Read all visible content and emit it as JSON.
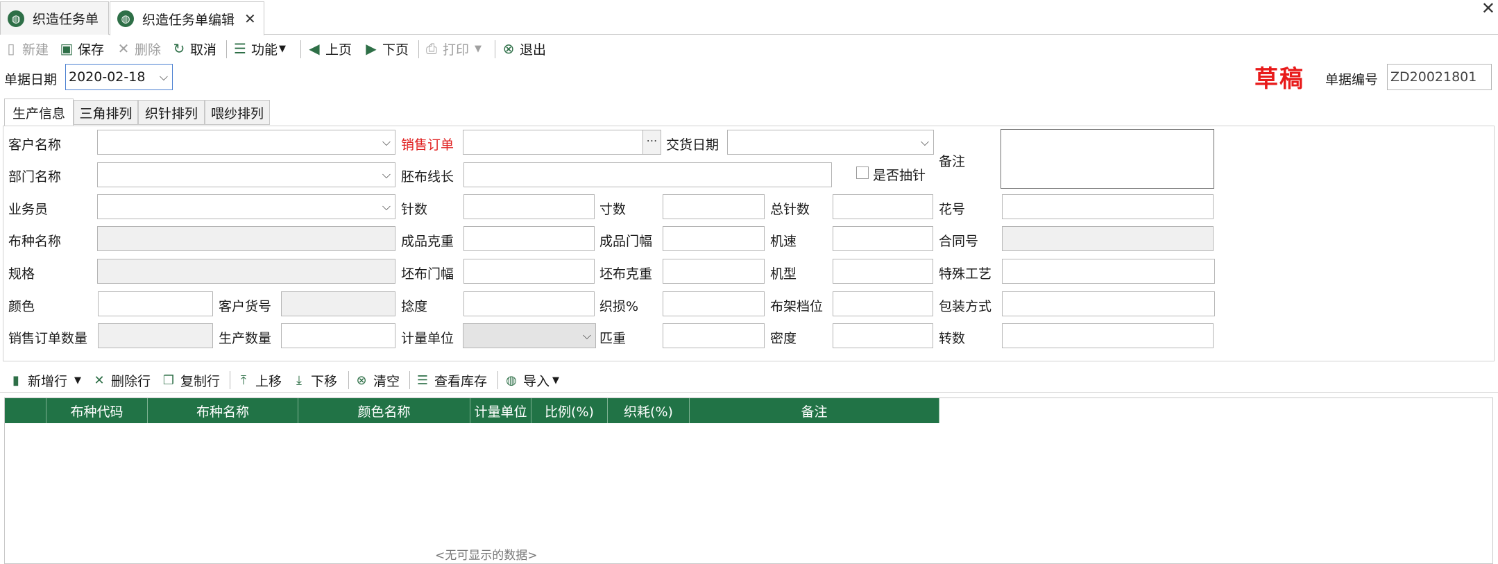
{
  "tabs": [
    {
      "label": "织造任务单"
    },
    {
      "label": "织造任务单编辑"
    }
  ],
  "toolbar": {
    "new": "新建",
    "save": "保存",
    "delete": "删除",
    "cancel": "取消",
    "function": "功能",
    "prev": "上页",
    "next": "下页",
    "print": "打印",
    "exit": "退出"
  },
  "header": {
    "date_label": "单据日期",
    "date_value": "2020-02-18",
    "status_stamp": "草稿",
    "docno_label": "单据编号",
    "docno_value": "ZD20021801"
  },
  "form_tabs": [
    "生产信息",
    "三角排列",
    "织针排列",
    "喂纱排列"
  ],
  "form": {
    "customer_name": "客户名称",
    "sales_order": "销售订单",
    "delivery_date": "交货日期",
    "remark": "备注",
    "dept_name": "部门名称",
    "grey_length": "胚布线长",
    "is_needle_draw": "是否抽针",
    "salesman": "业务员",
    "needle_count": "针数",
    "inch_count": "寸数",
    "total_needles": "总针数",
    "pattern_no": "花号",
    "fabric_name": "布种名称",
    "finished_weight": "成品克重",
    "finished_width": "成品门幅",
    "machine_speed": "机速",
    "contract_no": "合同号",
    "spec": "规格",
    "grey_width": "坯布门幅",
    "grey_weight": "坯布克重",
    "machine_type": "机型",
    "special_process": "特殊工艺",
    "color": "颜色",
    "customer_item_no": "客户货号",
    "twist": "捻度",
    "weaving_loss": "织损%",
    "rack_gear": "布架档位",
    "packing": "包装方式",
    "sales_qty": "销售订单数量",
    "production_qty": "生产数量",
    "unit": "计量单位",
    "piece_weight": "匹重",
    "density": "密度",
    "revolutions": "转数"
  },
  "grid_toolbar": {
    "add_row": "新增行",
    "delete_row": "删除行",
    "copy_row": "复制行",
    "move_up": "上移",
    "move_down": "下移",
    "clear": "清空",
    "view_stock": "查看库存",
    "import": "导入"
  },
  "grid": {
    "columns": [
      "",
      "布种代码",
      "布种名称",
      "颜色名称",
      "计量单位",
      "比例(%)",
      "织耗(%)",
      "备注"
    ],
    "empty_text": "<无可显示的数据>"
  },
  "colors": {
    "grid_header": "#217346",
    "stamp": "#e81b1b",
    "required_label": "#e02020"
  }
}
